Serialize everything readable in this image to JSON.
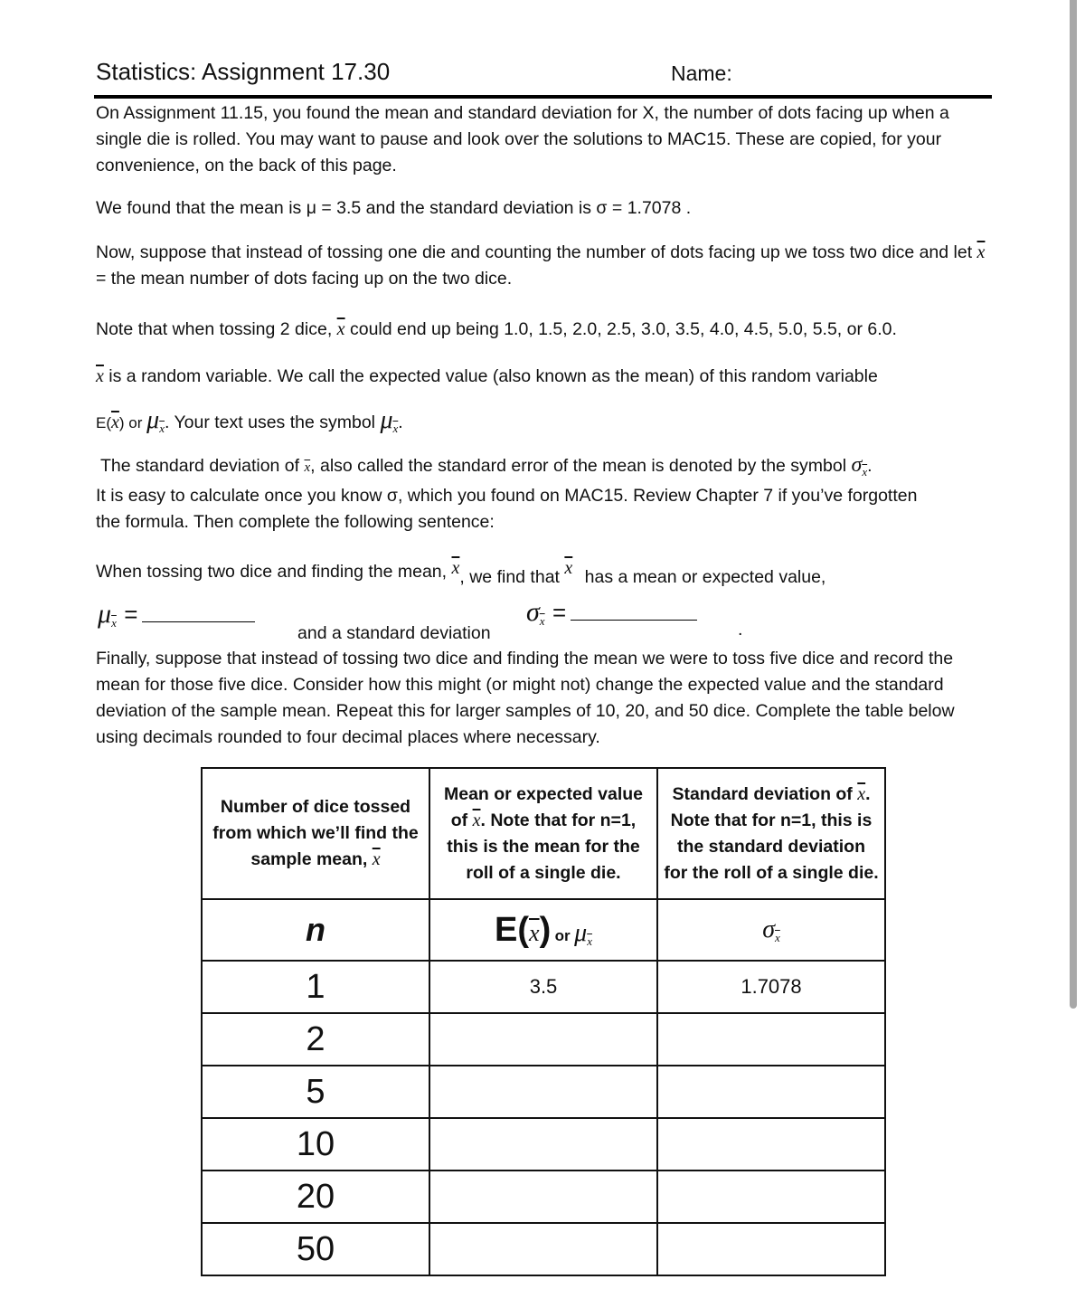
{
  "header": {
    "title": "Statistics:  Assignment 17.30",
    "name_label": "Name:"
  },
  "intro": {
    "p1": "On Assignment 11.15, you found the mean and standard deviation for X, the number of dots facing up when a single die is rolled.  You may want to pause and look over the solutions to MAC15.  These are copied, for your convenience, on the back of this page.",
    "p2": "We found that the mean is μ = 3.5 and the standard deviation is σ = 1.7078 .",
    "p3_a": "Now, suppose that instead of tossing one die and counting the number of dots facing up we toss two dice and let ",
    "p3_b": " = the mean number of dots facing up on the two dice.",
    "p4_a": "Note that when tossing 2 dice, ",
    "p4_b": " could end up being 1.0, 1.5, 2.0, 2.5, 3.0, 3.5, 4.0, 4.5, 5.0, 5.5, or 6.0.",
    "p5_b": " is a random variable.  We call the expected value (also known as the mean) of this random variable",
    "p6_a": "E(",
    "p6_b": ") or ",
    "p6_c": ".  Your text uses the symbol ",
    "p6_d": ".",
    "p7_a": "The standard deviation of ",
    "p7_b": ", also called the standard error of the mean is denoted by the symbol ",
    "p7_c": ".",
    "p8": "It is easy to calculate once you know σ, which you found on MAC15.  Review Chapter 7 if you’ve forgotten the formula. Then complete the following sentence:",
    "p9_a": "When tossing two dice and finding the mean, ",
    "p9_b": ", we find that ",
    "p9_c": " has a mean or expected value,",
    "p10_mid": "and a standard deviation",
    "p10_end": ".",
    "p11": "Finally, suppose that instead of tossing two dice and finding the mean we were to toss five dice and record the mean for those five dice.  Consider how this might (or might not) change the expected value and the standard deviation of the sample mean.  Repeat this for larger samples of 10, 20, and 50 dice.  Complete the table below using decimals rounded to four decimal places where necessary."
  },
  "symbols": {
    "xbar": "x",
    "mu": "μ",
    "sigma": "σ",
    "equals": "="
  },
  "table": {
    "headers": [
      {
        "text_a": "Number of dice tossed from which we’ll find the sample mean, ",
        "text_b": ""
      },
      {
        "text_a": "Mean or expected value of ",
        "text_b": ".  Note that for n=1, this is the mean for the roll of a single die."
      },
      {
        "text_a": "Standard deviation of ",
        "text_b": ".  Note that for n=1, this is the standard deviation for the roll of a single die."
      }
    ],
    "symbol_row": {
      "n": "n",
      "e_open": "E(",
      "e_close": ")",
      "or": "or"
    },
    "rows": [
      {
        "n": "1",
        "mean": "3.5",
        "sd": "1.7078"
      },
      {
        "n": "2",
        "mean": "",
        "sd": ""
      },
      {
        "n": "5",
        "mean": "",
        "sd": ""
      },
      {
        "n": "10",
        "mean": "",
        "sd": ""
      },
      {
        "n": "20",
        "mean": "",
        "sd": ""
      },
      {
        "n": "50",
        "mean": "",
        "sd": ""
      }
    ]
  }
}
